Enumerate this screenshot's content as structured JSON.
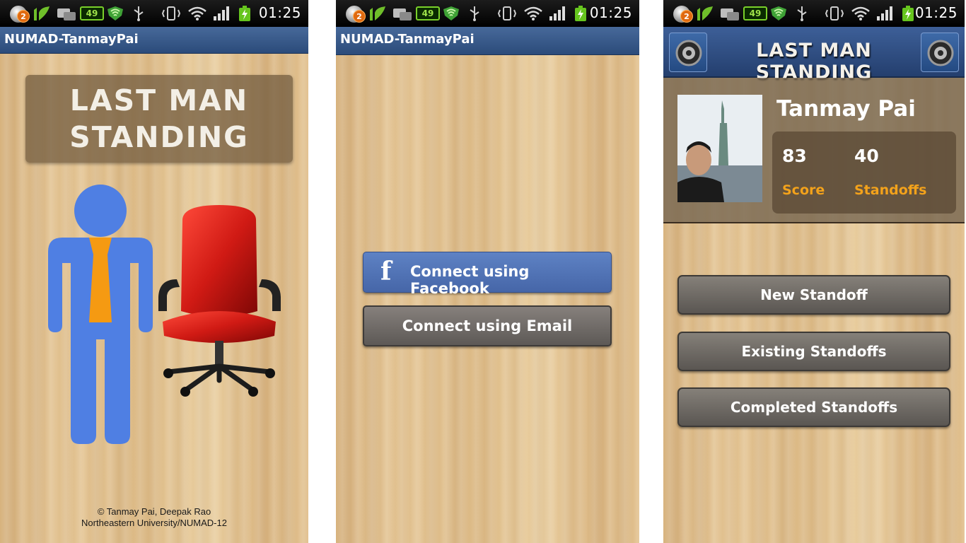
{
  "status_bar": {
    "notification_count": "2",
    "battery_small": "49",
    "time": "01:25"
  },
  "screen1": {
    "window_title": "NUMAD-TanmayPai",
    "logo_line1": "LAST MAN",
    "logo_line2": "STANDING",
    "credit_line1": "© Tanmay Pai, Deepak Rao",
    "credit_line2": "Northeastern University/NUMAD-12"
  },
  "screen2": {
    "window_title": "NUMAD-TanmayPai",
    "facebook_button": "Connect using Facebook",
    "facebook_icon": "f",
    "email_button": "Connect using Email"
  },
  "screen3": {
    "app_title": "LAST MAN STANDING",
    "player_name": "Tanmay Pai",
    "score_value": "83",
    "score_label": "Score",
    "standoffs_value": "40",
    "standoffs_label": "Standoffs",
    "buttons": {
      "new": "New Standoff",
      "existing": "Existing Standoffs",
      "completed": "Completed Standoffs"
    }
  },
  "colors": {
    "title_bar": "#3a5b8c",
    "facebook_blue": "#4f72b6",
    "accent_orange": "#f3a21b",
    "figure_blue": "#4f7fe3",
    "tie_orange": "#f59a12",
    "chair_red": "#d01a14"
  }
}
